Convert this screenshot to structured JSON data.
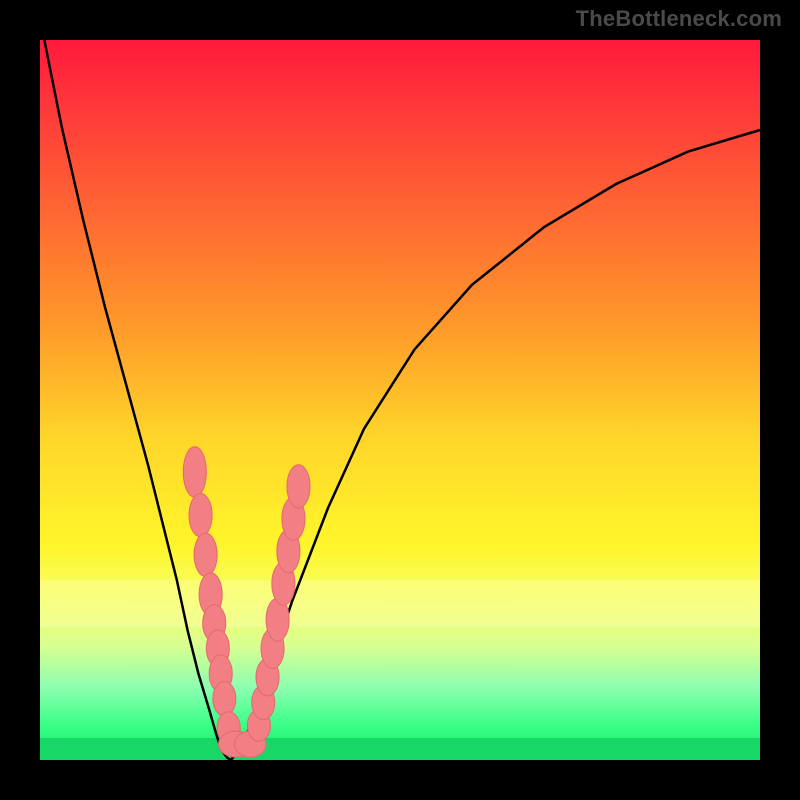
{
  "attribution": "TheBottleneck.com",
  "colors": {
    "frame": "#000000",
    "curve": "#000000",
    "marker_fill": "#f27f84",
    "marker_stroke": "#e56a70"
  },
  "chart_data": {
    "type": "line",
    "title": "",
    "xlabel": "",
    "ylabel": "",
    "xlim": [
      0,
      100
    ],
    "ylim": [
      0,
      100
    ],
    "grid": false,
    "legend": false,
    "series": [
      {
        "name": "left_branch",
        "x": [
          0,
          3,
          6,
          9,
          12,
          15,
          17,
          19,
          20.5,
          22,
          23.5,
          24.5,
          25.2,
          26,
          26.5
        ],
        "y": [
          103,
          88,
          75,
          63,
          52,
          41,
          33,
          25,
          18,
          12,
          7,
          3.5,
          1.4,
          0.3,
          0
        ]
      },
      {
        "name": "right_branch",
        "x": [
          26.5,
          27.5,
          28.5,
          30,
          32,
          35,
          40,
          45,
          52,
          60,
          70,
          80,
          90,
          100
        ],
        "y": [
          0,
          1.1,
          3,
          7,
          13,
          22,
          35,
          46,
          57,
          66,
          74,
          80,
          84.5,
          87.5
        ]
      }
    ],
    "markers": [
      {
        "x": 21.5,
        "y": 40,
        "rx": 1.6,
        "ry": 3.5
      },
      {
        "x": 22.3,
        "y": 34,
        "rx": 1.6,
        "ry": 3
      },
      {
        "x": 23.0,
        "y": 28.5,
        "rx": 1.6,
        "ry": 3
      },
      {
        "x": 23.7,
        "y": 23,
        "rx": 1.6,
        "ry": 3
      },
      {
        "x": 24.2,
        "y": 19,
        "rx": 1.6,
        "ry": 2.6
      },
      {
        "x": 24.7,
        "y": 15.5,
        "rx": 1.6,
        "ry": 2.6
      },
      {
        "x": 25.1,
        "y": 12,
        "rx": 1.6,
        "ry": 2.6
      },
      {
        "x": 25.6,
        "y": 8.5,
        "rx": 1.6,
        "ry": 2.4
      },
      {
        "x": 26.2,
        "y": 4.5,
        "rx": 1.6,
        "ry": 2.2
      },
      {
        "x": 27.2,
        "y": 2.2,
        "rx": 2.4,
        "ry": 1.8
      },
      {
        "x": 29.2,
        "y": 2.2,
        "rx": 2.2,
        "ry": 1.8
      },
      {
        "x": 30.4,
        "y": 4.8,
        "rx": 1.6,
        "ry": 2.2
      },
      {
        "x": 31.0,
        "y": 8.0,
        "rx": 1.6,
        "ry": 2.4
      },
      {
        "x": 31.6,
        "y": 11.5,
        "rx": 1.6,
        "ry": 2.6
      },
      {
        "x": 32.3,
        "y": 15.5,
        "rx": 1.6,
        "ry": 2.8
      },
      {
        "x": 33.0,
        "y": 19.5,
        "rx": 1.6,
        "ry": 3
      },
      {
        "x": 33.8,
        "y": 24.5,
        "rx": 1.6,
        "ry": 3
      },
      {
        "x": 34.5,
        "y": 29,
        "rx": 1.6,
        "ry": 3
      },
      {
        "x": 35.2,
        "y": 33.5,
        "rx": 1.6,
        "ry": 3
      },
      {
        "x": 35.9,
        "y": 38,
        "rx": 1.6,
        "ry": 3
      }
    ]
  }
}
